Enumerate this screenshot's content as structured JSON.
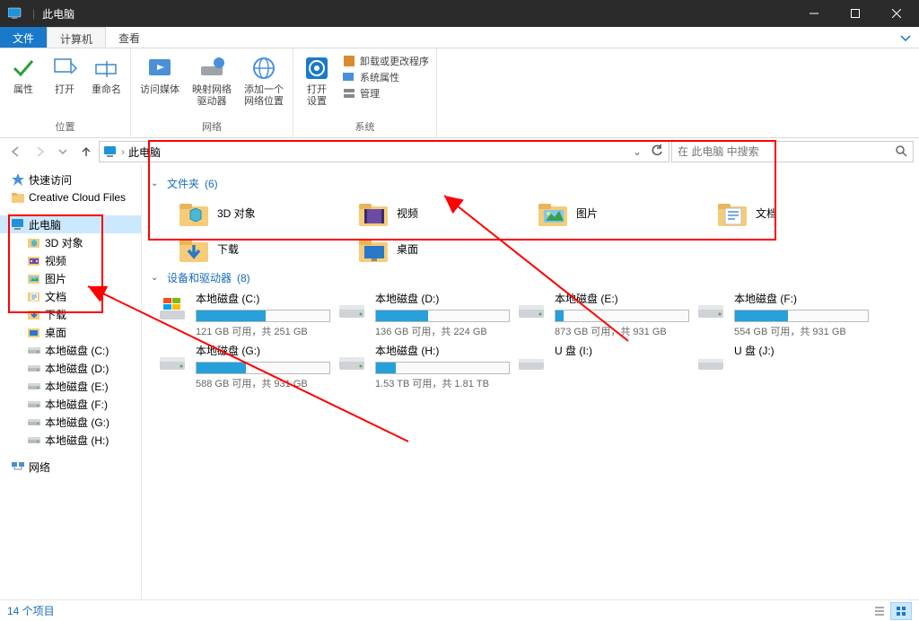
{
  "title": "此电脑",
  "tabs": {
    "file": "文件",
    "computer": "计算机",
    "view": "查看"
  },
  "ribbon": {
    "groups": [
      {
        "label": "位置",
        "items": [
          {
            "label": "属性"
          },
          {
            "label": "打开"
          },
          {
            "label": "重命名"
          }
        ]
      },
      {
        "label": "网络",
        "items": [
          {
            "label": "访问媒体"
          },
          {
            "label": "映射网络\n驱动器"
          },
          {
            "label": "添加一个\n网络位置"
          }
        ]
      },
      {
        "label": "系统",
        "items": [
          {
            "label": "打开\n设置"
          }
        ],
        "small": [
          {
            "label": "卸载或更改程序"
          },
          {
            "label": "系统属性"
          },
          {
            "label": "管理"
          }
        ]
      }
    ]
  },
  "address": {
    "text": "此电脑"
  },
  "search": {
    "placeholder": "在 此电脑 中搜索"
  },
  "sidebar": [
    {
      "label": "快速访问",
      "icon": "star",
      "depth": 1
    },
    {
      "label": "Creative Cloud Files",
      "icon": "folder-cc",
      "depth": 1
    },
    {
      "sep": true
    },
    {
      "label": "此电脑",
      "icon": "pc",
      "depth": 1,
      "selected": true
    },
    {
      "label": "3D 对象",
      "icon": "3d",
      "depth": 2
    },
    {
      "label": "视频",
      "icon": "video",
      "depth": 2
    },
    {
      "label": "图片",
      "icon": "pic",
      "depth": 2
    },
    {
      "label": "文档",
      "icon": "doc",
      "depth": 2
    },
    {
      "label": "下载",
      "icon": "dl",
      "depth": 2
    },
    {
      "label": "桌面",
      "icon": "desk",
      "depth": 2
    },
    {
      "label": "本地磁盘 (C:)",
      "icon": "drive",
      "depth": 2
    },
    {
      "label": "本地磁盘 (D:)",
      "icon": "drive",
      "depth": 2
    },
    {
      "label": "本地磁盘 (E:)",
      "icon": "drive",
      "depth": 2
    },
    {
      "label": "本地磁盘 (F:)",
      "icon": "drive",
      "depth": 2
    },
    {
      "label": "本地磁盘 (G:)",
      "icon": "drive",
      "depth": 2
    },
    {
      "label": "本地磁盘 (H:)",
      "icon": "drive",
      "depth": 2
    },
    {
      "sep": true
    },
    {
      "label": "网络",
      "icon": "net",
      "depth": 1
    }
  ],
  "content": {
    "folders_header_label": "文件夹",
    "folders_count": "(6)",
    "folders": [
      {
        "label": "3D 对象",
        "icon": "3d"
      },
      {
        "label": "视频",
        "icon": "video"
      },
      {
        "label": "图片",
        "icon": "pic"
      },
      {
        "label": "文档",
        "icon": "doc"
      },
      {
        "label": "下载",
        "icon": "dl"
      },
      {
        "label": "桌面",
        "icon": "desk"
      }
    ],
    "drives_header_label": "设备和驱动器",
    "drives_count": "(8)",
    "drives": [
      {
        "name": "本地磁盘 (C:)",
        "text": "121 GB 可用，共 251 GB",
        "pct": 52,
        "icon": "win"
      },
      {
        "name": "本地磁盘 (D:)",
        "text": "136 GB 可用，共 224 GB",
        "pct": 39,
        "icon": "hdd"
      },
      {
        "name": "本地磁盘 (E:)",
        "text": "873 GB 可用，共 931 GB",
        "pct": 6,
        "icon": "hdd"
      },
      {
        "name": "本地磁盘 (F:)",
        "text": "554 GB 可用，共 931 GB",
        "pct": 40,
        "icon": "hdd"
      },
      {
        "name": "本地磁盘 (G:)",
        "text": "588 GB 可用，共 931 GB",
        "pct": 37,
        "icon": "hdd"
      },
      {
        "name": "本地磁盘 (H:)",
        "text": "1.53 TB 可用，共 1.81 TB",
        "pct": 15,
        "icon": "hdd"
      },
      {
        "name": "U 盘 (I:)",
        "text": "",
        "pct": null,
        "icon": "usb"
      },
      {
        "name": "U 盘 (J:)",
        "text": "",
        "pct": null,
        "icon": "usb"
      }
    ]
  },
  "statusbar": {
    "text": "14 个项目"
  }
}
